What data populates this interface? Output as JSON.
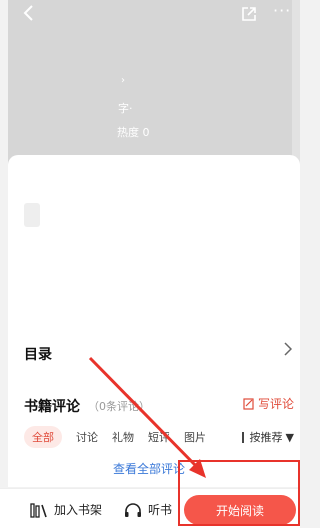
{
  "header": {
    "back_icon": "chevron-left-icon",
    "share_icon": "share-icon",
    "more_icon": "more-dots-icon",
    "more_glyph": "···"
  },
  "hero": {
    "arrow": "›",
    "word_label": "字·",
    "heat_label": "热度 0"
  },
  "catalog": {
    "label": "目录",
    "chevron_icon": "chevron-right-icon"
  },
  "reviews": {
    "title": "书籍评论",
    "count": "（0条评论）",
    "write_label": "写评论",
    "tabs": [
      "全部",
      "讨论",
      "礼物",
      "短评",
      "图片"
    ],
    "sort_label": "按推荐",
    "sort_arrow": "▼",
    "view_all": "查看全部评论"
  },
  "bottom_bar": {
    "add_shelf": "加入书架",
    "listen": "听书",
    "start_reading": "开始阅读"
  },
  "colors": {
    "accent": "#f5564a",
    "highlight_frame": "#e8332b",
    "link": "#3a78d8"
  }
}
